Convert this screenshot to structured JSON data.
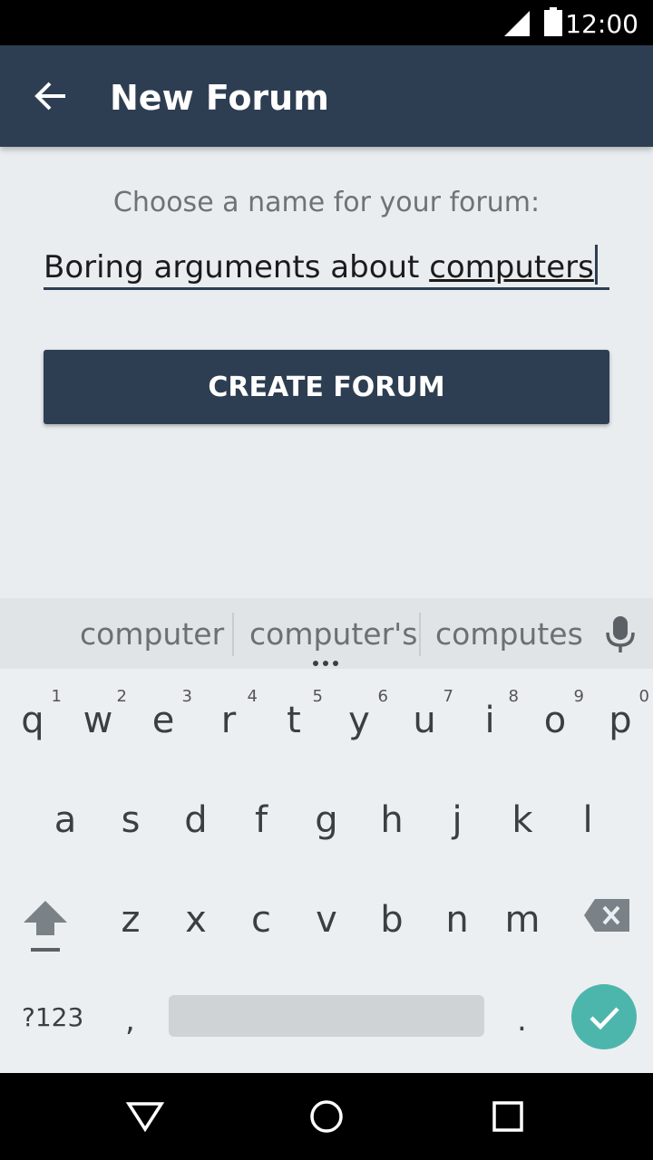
{
  "status_bar": {
    "time": "12:00"
  },
  "app_bar": {
    "title": "New Forum"
  },
  "form": {
    "prompt": "Choose a name for your forum:",
    "name_prefix": "Boring arguments about ",
    "name_composing": "computers",
    "create_label": "CREATE FORUM"
  },
  "keyboard": {
    "suggestions": [
      "computer",
      "computer's",
      "computes"
    ],
    "row1": [
      {
        "key": "q",
        "hint": "1"
      },
      {
        "key": "w",
        "hint": "2"
      },
      {
        "key": "e",
        "hint": "3"
      },
      {
        "key": "r",
        "hint": "4"
      },
      {
        "key": "t",
        "hint": "5"
      },
      {
        "key": "y",
        "hint": "6"
      },
      {
        "key": "u",
        "hint": "7"
      },
      {
        "key": "i",
        "hint": "8"
      },
      {
        "key": "o",
        "hint": "9"
      },
      {
        "key": "p",
        "hint": "0"
      }
    ],
    "row2": [
      "a",
      "s",
      "d",
      "f",
      "g",
      "h",
      "j",
      "k",
      "l"
    ],
    "row3": [
      "z",
      "x",
      "c",
      "v",
      "b",
      "n",
      "m"
    ],
    "symbols_label": "?123",
    "comma": ",",
    "period": ".",
    "accent_color": "#4db6ac"
  },
  "icons": {
    "back": "arrow-left-icon",
    "mic": "mic-icon",
    "shift": "shift-icon",
    "backspace": "backspace-icon",
    "enter": "check-icon"
  }
}
